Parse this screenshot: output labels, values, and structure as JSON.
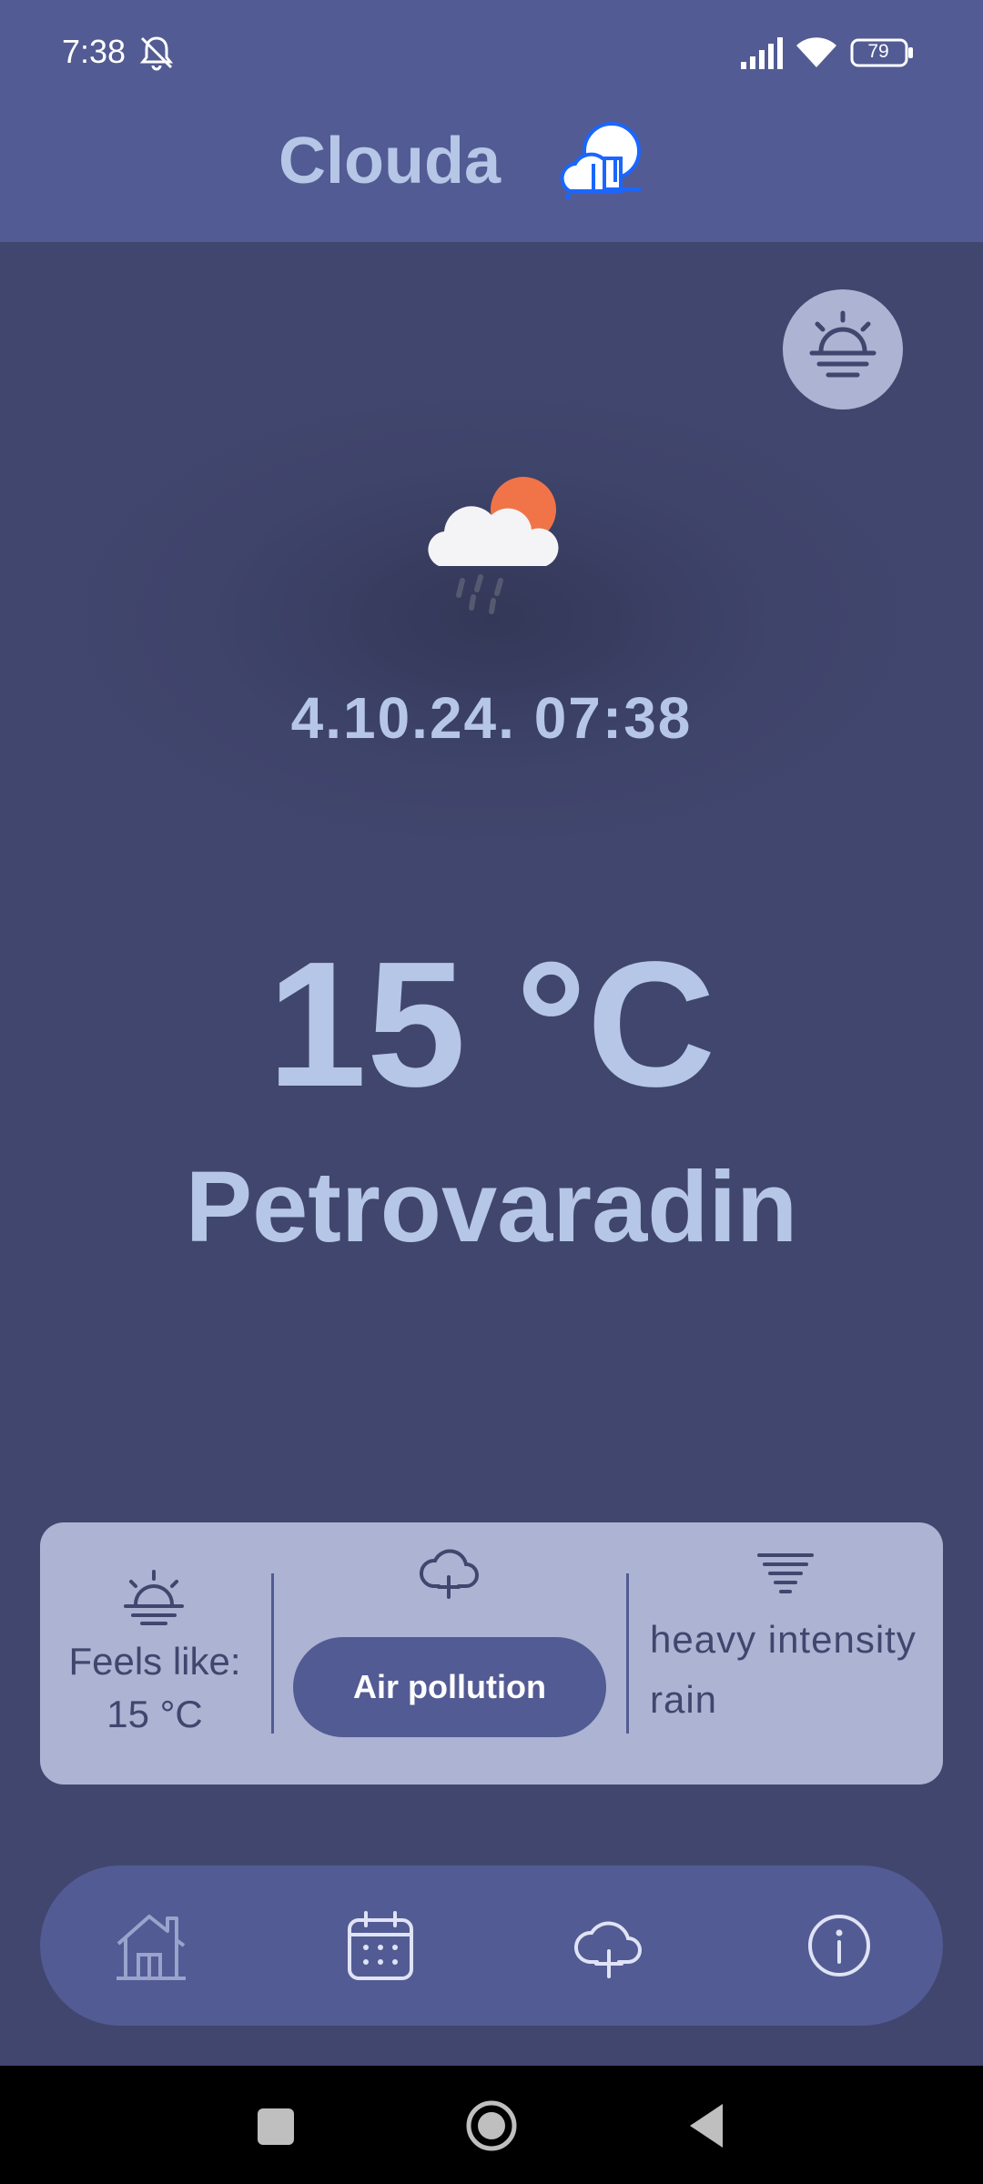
{
  "status_bar": {
    "time": "7:38",
    "battery": "79"
  },
  "header": {
    "app_title": "Clouda"
  },
  "main": {
    "datetime": "4.10.24. 07:38",
    "temperature": "15 °C",
    "city": "Petrovaradin"
  },
  "info_card": {
    "feels_like_label": "Feels like:",
    "feels_like_value": "15 °C",
    "air_pollution_button": "Air pollution",
    "description": "heavy intensity rain"
  },
  "colors": {
    "header_bg": "#525b93",
    "page_bg": "#41466e",
    "card_bg": "#adb3d3",
    "text_light": "#b6c6e6",
    "sun": "#f07448"
  },
  "icons": {
    "logo": "cloud-logo-icon",
    "sunrise": "sunrise-icon",
    "weather": "sun-cloud-rain-icon",
    "feels": "sunrise-icon",
    "air": "cloud-plus-icon",
    "wind": "tornado-icon",
    "nav": [
      "home-icon",
      "calendar-icon",
      "cloud-plus-icon",
      "info-icon"
    ]
  }
}
